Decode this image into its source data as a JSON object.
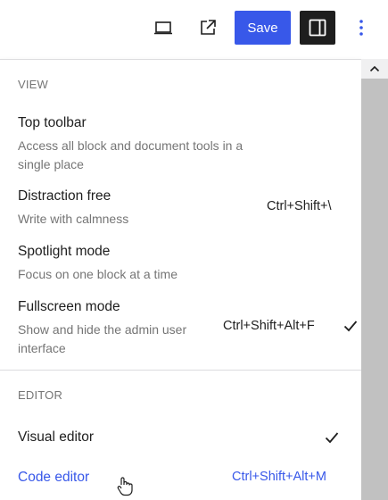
{
  "toolbar": {
    "save_label": "Save",
    "icons": [
      "laptop-icon",
      "external-link-icon",
      "sidebar-panel-icon",
      "more-vertical-icon"
    ]
  },
  "menu": {
    "view_section": "VIEW",
    "view_items": [
      {
        "title": "Top toolbar",
        "desc": "Access all block and document tools in a single place",
        "shortcut": "",
        "checked": false
      },
      {
        "title": "Distraction free",
        "desc": "Write with calmness",
        "shortcut": "Ctrl+Shift+\\",
        "checked": false
      },
      {
        "title": "Spotlight mode",
        "desc": "Focus on one block at a time",
        "shortcut": "",
        "checked": false
      },
      {
        "title": "Fullscreen mode",
        "desc": "Show and hide the admin user interface",
        "shortcut": "Ctrl+Shift+Alt+F",
        "checked": true
      }
    ],
    "editor_section": "EDITOR",
    "editor_items": [
      {
        "title": "Visual editor",
        "shortcut": "",
        "checked": true
      },
      {
        "title": "Code editor",
        "shortcut": "Ctrl+Shift+Alt+M",
        "checked": false
      }
    ]
  },
  "colors": {
    "accent": "#3858e9",
    "text": "#1e1e1e",
    "muted": "#757575"
  }
}
